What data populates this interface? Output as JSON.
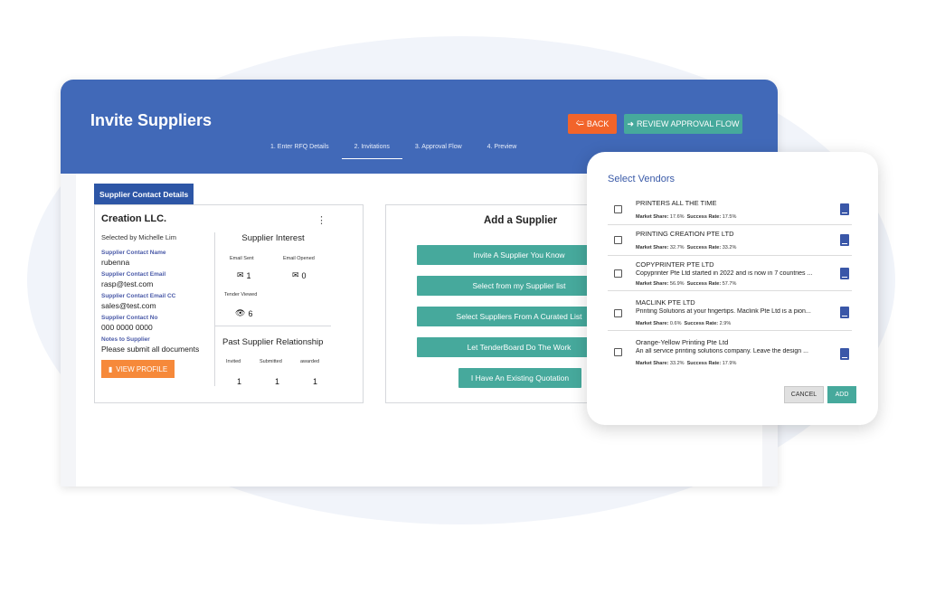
{
  "app": {
    "title": "Invite Suppliers"
  },
  "header": {
    "back_label": "BACK",
    "review_label": "REVIEW APPROVAL FLOW"
  },
  "steps": [
    {
      "label": "1. Enter RFQ Details"
    },
    {
      "label": "2. Invitations",
      "active": true
    },
    {
      "label": "3. Approval Flow"
    },
    {
      "label": "4. Preview"
    }
  ],
  "contact": {
    "tab_label": "Supplier Contact Details",
    "company": "Creation LLC.",
    "selected_by": "Selected by Michelle Lim",
    "fields": [
      {
        "label": "Supplier Contact Name",
        "value": "rubenna"
      },
      {
        "label": "Supplier Contact Email",
        "value": "rasp@test.com"
      },
      {
        "label": "Supplier Contact Email CC",
        "value": "sales@test.com"
      },
      {
        "label": "Supplier Contact No",
        "value": "000 0000 0000"
      },
      {
        "label": "Notes to Supplier",
        "value": "Please submit all documents"
      }
    ],
    "view_profile_label": "VIEW PROFILE",
    "interest": {
      "title": "Supplier Interest",
      "email_sent_label": "Email Sent",
      "email_sent_value": "1",
      "email_opened_label": "Email Opened",
      "email_opened_value": "0",
      "tender_viewed_label": "Tender Viewed",
      "tender_viewed_value": "6"
    },
    "past": {
      "title": "Past Supplier Relationship",
      "headers": [
        "Invited",
        "Submitted",
        "awarded"
      ],
      "values": [
        "1",
        "1",
        "1"
      ]
    }
  },
  "add_supplier": {
    "title": "Add a Supplier",
    "buttons": [
      "Invite A Supplier You Know",
      "Select from my Supplier list",
      "Select Suppliers From A Curated List",
      "Let TenderBoard Do The Work",
      "I Have An Existing Quotation"
    ]
  },
  "modal": {
    "title": "Select Vendors",
    "market_share_label": "Market Share:",
    "success_rate_label": "Success Rate:",
    "vendors": [
      {
        "name": "PRINTERS ALL THE TIME",
        "desc": "",
        "market_share": "17.6%",
        "success_rate": "17.5%"
      },
      {
        "name": "PRINTING CREATION PTE LTD",
        "desc": "",
        "market_share": "32.7%",
        "success_rate": "33.2%"
      },
      {
        "name": "COPYPRINTER PTE LTD",
        "desc": "Copyprinter Pte Ltd started in 2022 and is now in 7 countries ...",
        "market_share": "56.9%",
        "success_rate": "57.7%"
      },
      {
        "name": "MACLINK PTE LTD",
        "desc": "Printing Solutions at your fingertips. Maclink Pte Ltd is a pion...",
        "market_share": "0.6%",
        "success_rate": "2.9%"
      },
      {
        "name": "Orange-Yellow Printing Pte Ltd",
        "desc": "An all service printing solutions company. Leave the design ...",
        "market_share": "33.2%",
        "success_rate": "17.9%"
      }
    ],
    "cancel_label": "CANCEL",
    "add_label": "ADD"
  },
  "colors": {
    "header": "#4169b8",
    "teal": "#46a99c",
    "orange": "#f2642a",
    "profile_orange": "#f6893a",
    "tab_blue": "#2d56a6"
  }
}
